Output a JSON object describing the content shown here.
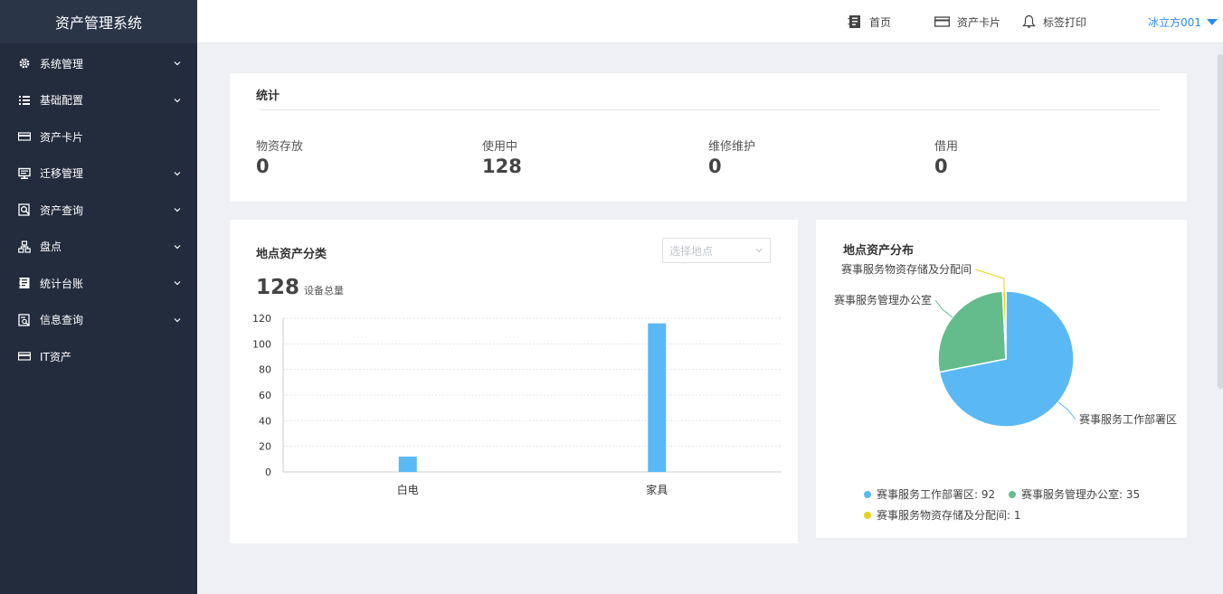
{
  "app": {
    "title": "资产管理系统"
  },
  "sidebar": {
    "items": [
      {
        "label": "系统管理",
        "icon": "gear-icon",
        "has_submenu": true
      },
      {
        "label": "基础配置",
        "icon": "list-icon",
        "has_submenu": true
      },
      {
        "label": "资产卡片",
        "icon": "card-icon",
        "has_submenu": false
      },
      {
        "label": "迁移管理",
        "icon": "monitor-icon",
        "has_submenu": true
      },
      {
        "label": "资产查询",
        "icon": "search-doc-icon",
        "has_submenu": true
      },
      {
        "label": "盘点",
        "icon": "hierarchy-icon",
        "has_submenu": true
      },
      {
        "label": "统计台账",
        "icon": "ledger-icon",
        "has_submenu": true
      },
      {
        "label": "信息查询",
        "icon": "info-search-icon",
        "has_submenu": true
      },
      {
        "label": "IT资产",
        "icon": "card-icon",
        "has_submenu": false
      }
    ]
  },
  "topbar": {
    "home": "首页",
    "asset_card": "资产卡片",
    "label_print": "标签打印",
    "user": "冰立方001"
  },
  "stats": {
    "title": "统计",
    "items": [
      {
        "label": "物资存放",
        "value": "0"
      },
      {
        "label": "使用中",
        "value": "128"
      },
      {
        "label": "维修维护",
        "value": "0"
      },
      {
        "label": "借用",
        "value": "0"
      }
    ]
  },
  "location_category": {
    "title": "地点资产分类",
    "select_placeholder": "选择地点",
    "total_value": "128",
    "total_label": "设备总量"
  },
  "location_distribution": {
    "title": "地点资产分布"
  },
  "colors": {
    "sidebar_bg": "#232c3d",
    "accent": "#2d8cf0",
    "bar": "#5ab9f5",
    "pie_blue": "#5ab9f5",
    "pie_green": "#64bc8c",
    "pie_yellow": "#e8d11a"
  },
  "chart_data": [
    {
      "type": "bar",
      "categories": [
        "白电",
        "家具"
      ],
      "values": [
        12,
        116
      ],
      "ylim": [
        0,
        120
      ],
      "yticks": [
        0,
        20,
        40,
        60,
        80,
        100,
        120
      ],
      "grid": true
    },
    {
      "type": "pie",
      "labels": [
        "赛事服务工作部署区",
        "赛事服务管理办公室",
        "赛事服务物资存储及分配间"
      ],
      "values": [
        92,
        35,
        1
      ],
      "legend": [
        "赛事服务工作部署区: 92",
        "赛事服务管理办公室: 35",
        "赛事服务物资存储及分配间: 1"
      ],
      "legend_position": "bottom"
    }
  ]
}
